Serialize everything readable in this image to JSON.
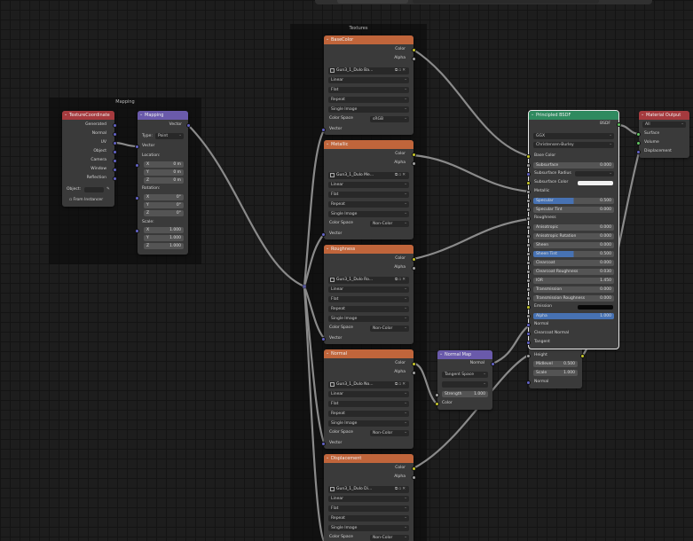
{
  "frames": {
    "mapping": "Mapping",
    "textures": "Textures"
  },
  "texcoord": {
    "title": "TextureCoordinate",
    "outputs": [
      "Generated",
      "Normal",
      "UV",
      "Object",
      "Camera",
      "Window",
      "Reflection"
    ],
    "object_label": "Object:",
    "from_instancer": "From Instancer"
  },
  "mapping": {
    "title": "Mapping",
    "output": "Vector",
    "type_label": "Type:",
    "type_value": "Point",
    "vector_label": "Vector",
    "location_label": "Location:",
    "location": [
      {
        "axis": "X",
        "value": "0 m"
      },
      {
        "axis": "Y",
        "value": "0 m"
      },
      {
        "axis": "Z",
        "value": "0 m"
      }
    ],
    "rotation_label": "Rotation:",
    "rotation": [
      {
        "axis": "X",
        "value": "0°"
      },
      {
        "axis": "Y",
        "value": "0°"
      },
      {
        "axis": "Z",
        "value": "0°"
      }
    ],
    "scale_label": "Scale:",
    "scale": [
      {
        "axis": "X",
        "value": "1.000"
      },
      {
        "axis": "Y",
        "value": "1.000"
      },
      {
        "axis": "Z",
        "value": "1.000"
      }
    ]
  },
  "tex_common": {
    "out_color": "Color",
    "out_alpha": "Alpha",
    "interpolation": "Linear",
    "projection": "Flat",
    "extension": "Repeat",
    "source": "Single Image",
    "colorspace_label": "Color Space",
    "vector_label": "Vector"
  },
  "textures": [
    {
      "title": "BaseColor",
      "image": "Gun3_1_Dulo Ba...",
      "colorspace": "sRGB"
    },
    {
      "title": "Metallic",
      "image": "Gun3_1_Dulo Me...",
      "colorspace": "Non-Color"
    },
    {
      "title": "Roughness",
      "image": "Gun3_1_Dulo Ro...",
      "colorspace": "Non-Color"
    },
    {
      "title": "Normal",
      "image": "Gun3_1_Dulo No...",
      "colorspace": "Non-Color"
    },
    {
      "title": "Displacement",
      "image": "Gun3_1_Dulo Di...",
      "colorspace": "Non-Color"
    }
  ],
  "normalmap": {
    "title": "Normal Map",
    "output": "Normal",
    "space": "Tangent Space",
    "strength_label": "Strength",
    "strength": "1.000",
    "color_label": "Color"
  },
  "bsdf": {
    "title": "Principled BSDF",
    "output": "BSDF",
    "distribution": "GGX",
    "subsurface_method": "Christensen-Burley",
    "rows": [
      {
        "label": "Base Color",
        "kind": "socket"
      },
      {
        "label": "Subsurface",
        "value": "0.000"
      },
      {
        "label": "Subsurface Radius",
        "kind": "dropdown"
      },
      {
        "label": "Subsurface Color",
        "kind": "white"
      },
      {
        "label": "Metallic",
        "kind": "socket"
      },
      {
        "label": "Specular",
        "value": "0.500",
        "fill": 0.5
      },
      {
        "label": "Specular Tint",
        "value": "0.000"
      },
      {
        "label": "Roughness",
        "kind": "socket"
      },
      {
        "label": "Anisotropic",
        "value": "0.000"
      },
      {
        "label": "Anisotropic Rotation",
        "value": "0.000"
      },
      {
        "label": "Sheen",
        "value": "0.000"
      },
      {
        "label": "Sheen Tint",
        "value": "0.500",
        "fill": 0.5
      },
      {
        "label": "Clearcoat",
        "value": "0.000"
      },
      {
        "label": "Clearcoat Roughness",
        "value": "0.030"
      },
      {
        "label": "IOR",
        "value": "1.450"
      },
      {
        "label": "Transmission",
        "value": "0.000"
      },
      {
        "label": "Transmission Roughness",
        "value": "0.000"
      },
      {
        "label": "Emission",
        "kind": "black"
      },
      {
        "label": "Alpha",
        "value": "1.000",
        "fill": 1.0
      },
      {
        "label": "Normal",
        "kind": "socket"
      },
      {
        "label": "Clearcoat Normal",
        "kind": "socket"
      },
      {
        "label": "Tangent",
        "kind": "socket"
      }
    ]
  },
  "displacement": {
    "height_label": "Height",
    "midlevel_label": "Midlevel",
    "midlevel": "0.500",
    "scale_label": "Scale",
    "scale": "1.000",
    "normal_label": "Normal"
  },
  "output": {
    "title": "Material Output",
    "target": "All",
    "inputs": [
      "Surface",
      "Volume",
      "Displacement"
    ]
  },
  "colors": {
    "texture_header": "#c0653b",
    "vector_header": "#6a5aab",
    "input_header": "#a53a3e",
    "shader_header": "#2f8a5f",
    "socket_color": "#c7c729",
    "socket_float": "#a1a1a1",
    "socket_vector": "#6363c7",
    "socket_shader": "#63c763"
  }
}
